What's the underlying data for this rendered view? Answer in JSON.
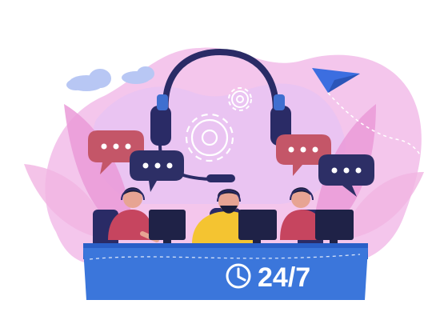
{
  "illustration": {
    "subject": "customer-support-call-center",
    "badge": {
      "text": "24/7",
      "icon": "clock-icon"
    },
    "colors": {
      "background": "#ffffff",
      "blob_pink": "#f4c6ec",
      "blob_lavender": "#e7c3f3",
      "leaf_pink": "#ea9ad8",
      "headset_navy": "#2a2b66",
      "headset_blue": "#3f6fd0",
      "desk_blue": "#3b76db",
      "desk_dark": "#2a5fc7",
      "bubble_red": "#c45668",
      "bubble_navy": "#2d2f66",
      "skin": "#e7a493",
      "hair": "#1b1d3a",
      "shirt_red": "#c6455f",
      "shirt_yellow": "#f4c431",
      "monitor_navy": "#1f2247",
      "paper_plane_blue": "#3c6ee0",
      "cloud_blue": "#b8c7f4"
    }
  }
}
